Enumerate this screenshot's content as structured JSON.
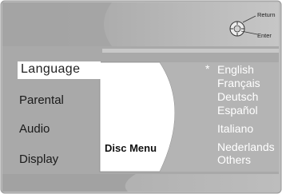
{
  "hints": {
    "return_label": "Return",
    "enter_label": "Enter"
  },
  "sidebar": {
    "items": [
      {
        "label": "Language",
        "selected": true
      },
      {
        "label": "Parental",
        "selected": false
      },
      {
        "label": "Audio",
        "selected": false
      },
      {
        "label": "Display",
        "selected": false
      }
    ]
  },
  "submenu": {
    "title": "Disc Menu"
  },
  "options": {
    "selected_marker": "*",
    "items": [
      "English",
      "Français",
      "Deutsch",
      "Español",
      "Italiano",
      "Nederlands",
      "Others"
    ],
    "selected_index": 0
  },
  "colors": {
    "panel_gray": "#b0b0b0",
    "panel_dark": "#8f8f8f",
    "frame_white": "#ffffff",
    "border": "#8a8a8a",
    "option_text": "#ffffff"
  }
}
